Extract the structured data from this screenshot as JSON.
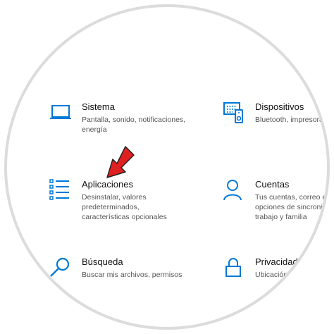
{
  "colors": {
    "accent": "#0078d7",
    "arrow": "#e02020"
  },
  "settings": {
    "sistema": {
      "icon": "laptop-icon",
      "title": "Sistema",
      "desc": [
        "Pantalla, sonido, notificaciones,",
        "energía"
      ]
    },
    "dispositivos": {
      "icon": "devices-icon",
      "title": "Dispositivos",
      "desc": [
        "Bluetooth, impresoras, m"
      ]
    },
    "aplicaciones": {
      "icon": "apps-list-icon",
      "title": "Aplicaciones",
      "desc": [
        "Desinstalar, valores",
        "predeterminados,",
        "características opcionales"
      ]
    },
    "cuentas": {
      "icon": "person-icon",
      "title": "Cuentas",
      "desc": [
        "Tus cuentas, correo ele",
        "opciones de sincroniza",
        "trabajo y familia"
      ]
    },
    "busqueda": {
      "icon": "search-icon",
      "title": "Búsqueda",
      "desc": [
        "Buscar mis archivos, permisos"
      ]
    },
    "privacidad": {
      "icon": "lock-icon",
      "title": "Privacidad",
      "desc": [
        "Ubicación, cámara, micr"
      ]
    }
  }
}
